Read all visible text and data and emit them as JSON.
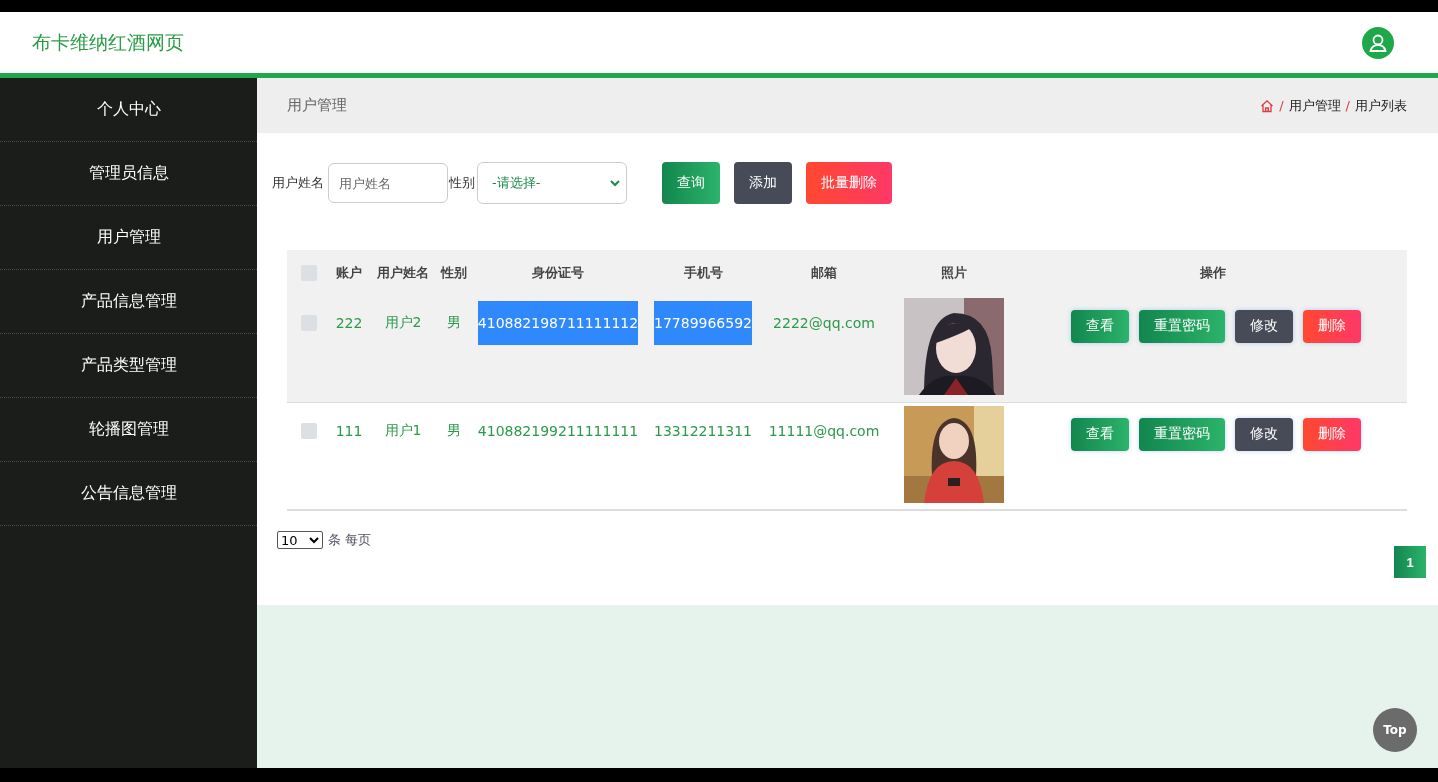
{
  "header": {
    "title": "布卡维纳红酒网页"
  },
  "sidebar": {
    "items": [
      {
        "label": "个人中心"
      },
      {
        "label": "管理员信息"
      },
      {
        "label": "用户管理"
      },
      {
        "label": "产品信息管理"
      },
      {
        "label": "产品类型管理"
      },
      {
        "label": "轮播图管理"
      },
      {
        "label": "公告信息管理"
      }
    ]
  },
  "page_title": "用户管理",
  "breadcrumb": [
    {
      "separator": "/",
      "label": "用户管理"
    },
    {
      "separator": "/",
      "label": "用户列表"
    }
  ],
  "search": {
    "name_label": "用户姓名",
    "name_placeholder": "用户姓名",
    "gender_label": "性别",
    "gender_value": "-请选择-",
    "buttons": [
      {
        "label": "查询",
        "kind": "primary"
      },
      {
        "label": "添加",
        "kind": "dark"
      },
      {
        "label": "批量删除",
        "kind": "danger"
      }
    ]
  },
  "table": {
    "select_all_checked": false,
    "columns": [
      "账户",
      "用户姓名",
      "性别",
      "身份证号",
      "手机号",
      "邮箱",
      "照片",
      "操作"
    ],
    "rows": [
      {
        "checked": false,
        "hovered": true,
        "account": "222",
        "name": "用户2",
        "gender": "男",
        "id_number": "410882198711111112",
        "id_highlighted": true,
        "phone": "17789966592",
        "phone_highlighted": true,
        "email": "2222@qq.com",
        "actions": [
          {
            "label": "查看",
            "kind": "primary"
          },
          {
            "label": "重置密码",
            "kind": "primary"
          },
          {
            "label": "修改",
            "kind": "dark"
          },
          {
            "label": "删除",
            "kind": "danger"
          }
        ]
      },
      {
        "checked": false,
        "hovered": false,
        "account": "111",
        "name": "用户1",
        "gender": "男",
        "id_number": "410882199211111111",
        "id_highlighted": false,
        "phone": "13312211311",
        "phone_highlighted": false,
        "email": "11111@qq.com",
        "actions": [
          {
            "label": "查看",
            "kind": "primary"
          },
          {
            "label": "重置密码",
            "kind": "primary"
          },
          {
            "label": "修改",
            "kind": "dark"
          },
          {
            "label": "删除",
            "kind": "danger"
          }
        ]
      }
    ]
  },
  "pagination": {
    "page_size": "10",
    "page_size_suffix": "条 每页",
    "pages": [
      {
        "label": "1",
        "selected": true
      }
    ]
  },
  "back_to_top": "Top"
}
